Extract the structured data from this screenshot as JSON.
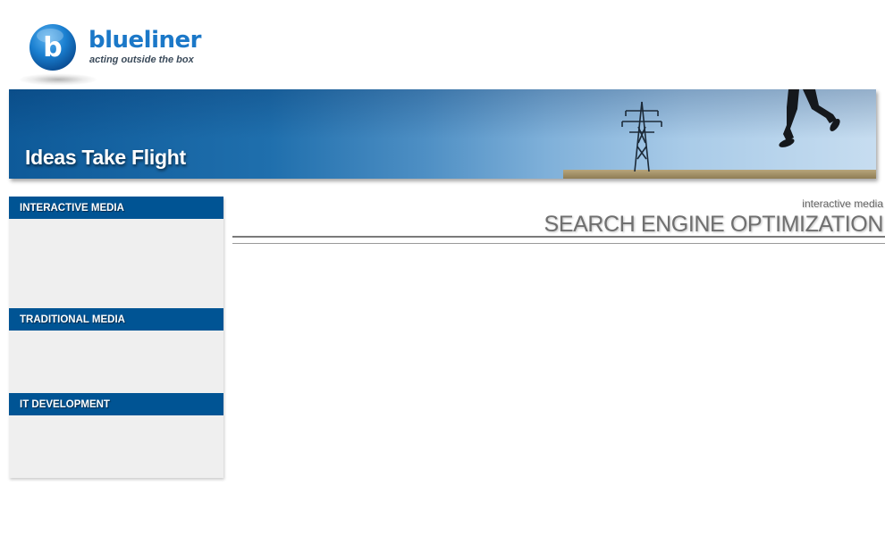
{
  "logo": {
    "brand": "blueliner",
    "badge_letter": "b",
    "tagline": "acting outside the box",
    "brand_color": "#1b78c8"
  },
  "banner": {
    "headline": "Ideas Take Flight"
  },
  "sidebar": {
    "sections": [
      {
        "label": "INTERACTIVE MEDIA"
      },
      {
        "label": "TRADITIONAL MEDIA"
      },
      {
        "label": "IT DEVELOPMENT"
      }
    ],
    "header_color": "#005494"
  },
  "content": {
    "category": "interactive media",
    "title": "SEARCH ENGINE OPTIMIZATION"
  }
}
